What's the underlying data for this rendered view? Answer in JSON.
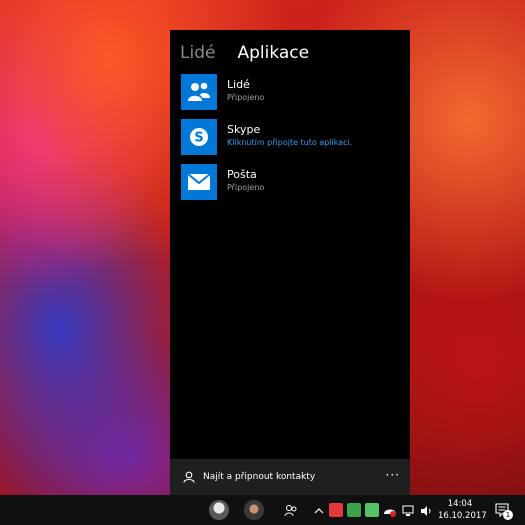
{
  "panel": {
    "tabs": [
      "Lidé",
      "Aplikace"
    ],
    "apps": [
      {
        "name": "Lidé",
        "status": "Připojeno",
        "icon": "people-app-icon"
      },
      {
        "name": "Skype",
        "status": "Kliknutím připojte tuto aplikaci.",
        "icon": "skype-icon"
      },
      {
        "name": "Pošta",
        "status": "Připojeno",
        "icon": "mail-icon"
      }
    ],
    "find_contacts_label": "Najít a připnout kontakty",
    "more_label": "···"
  },
  "taskbar": {
    "time": "14:04",
    "date": "16.10.2017",
    "notification_count": "1"
  },
  "colors": {
    "accent": "#0078d7",
    "link": "#3d9ae8",
    "panel_bg": "#000000",
    "taskbar_bg": "#101010"
  }
}
